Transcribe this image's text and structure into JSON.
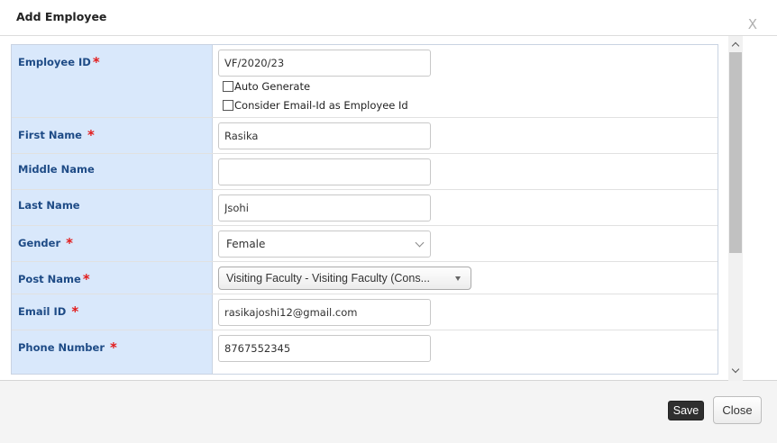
{
  "dialog": {
    "title": "Add Employee",
    "close_glyph": "X"
  },
  "form": {
    "employee_id": {
      "label": "Employee ID",
      "required_mark": "*",
      "value": "VF/2020/23",
      "auto_generate_label": "Auto Generate",
      "consider_email_label": "Consider Email-Id as Employee Id",
      "auto_generate_checked": false,
      "consider_email_checked": false
    },
    "first_name": {
      "label": "First Name",
      "required_mark": "*",
      "value": "Rasika"
    },
    "middle_name": {
      "label": "Middle Name",
      "value": ""
    },
    "last_name": {
      "label": "Last Name",
      "value": "Jsohi"
    },
    "gender": {
      "label": "Gender",
      "required_mark": "*",
      "selected": "Female"
    },
    "post_name": {
      "label": "Post Name",
      "required_mark": "*",
      "selected": "Visiting Faculty - Visiting Faculty (Cons..."
    },
    "email_id": {
      "label": "Email ID",
      "required_mark": "*",
      "value": "rasikajoshi12@gmail.com"
    },
    "phone_number": {
      "label": "Phone Number",
      "required_mark": "*",
      "value": "8767552345"
    }
  },
  "footer": {
    "save_label": "Save",
    "close_label": "Close"
  },
  "colors": {
    "label_bg": "#d9e8fb",
    "label_text": "#1e4b86",
    "required": "#e21b1b",
    "save_bg": "#2f2f2f"
  }
}
